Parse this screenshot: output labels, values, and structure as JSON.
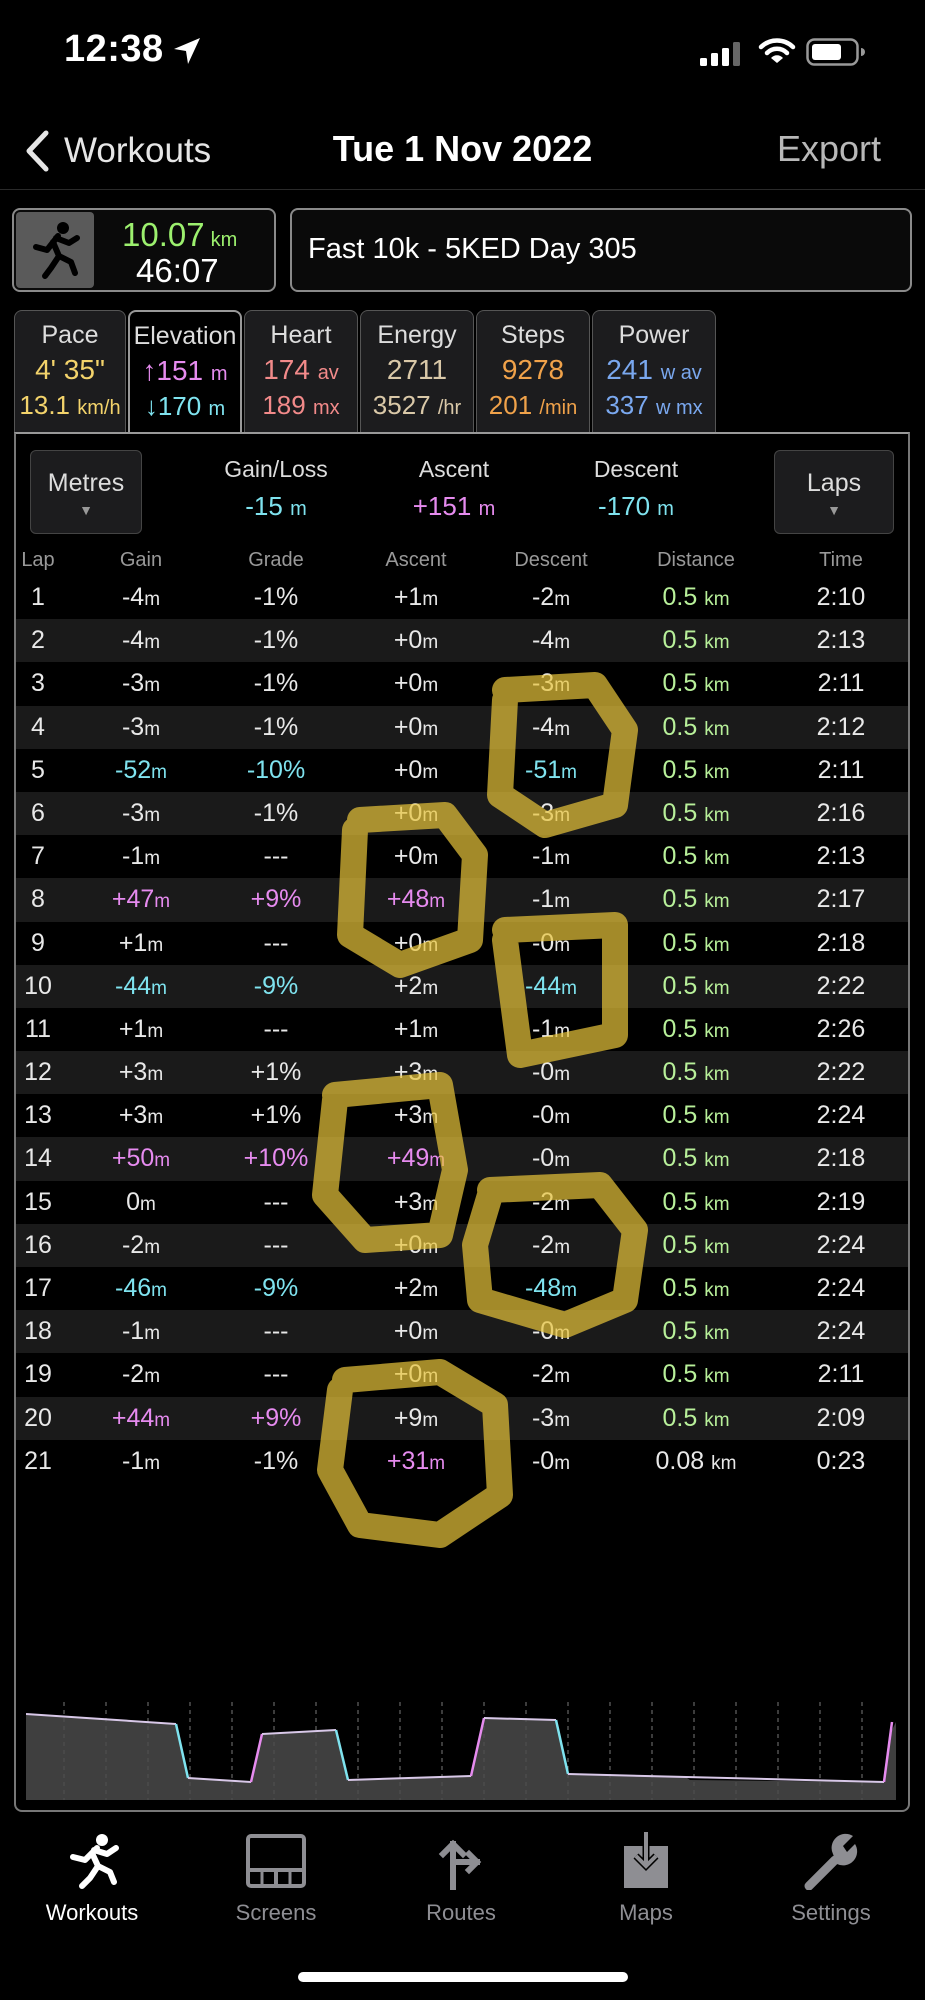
{
  "status_bar": {
    "time": "12:38"
  },
  "nav": {
    "back_label": "Workouts",
    "title": "Tue 1 Nov 2022",
    "export_label": "Export"
  },
  "summary": {
    "distance": "10.07",
    "distance_unit": "km",
    "duration": "46:07",
    "workout_title": "Fast 10k - 5KED Day 305"
  },
  "tabs": [
    {
      "label": "Pace",
      "line1": "4' 35\"",
      "line1_color": "#f3d36b",
      "line2": "13.1",
      "line2_unit": "km/h",
      "line2_color": "#f3d36b"
    },
    {
      "label": "Elevation",
      "line1": "↑151",
      "line1_unit": "m",
      "line1_color": "#e68bef",
      "line2": "↓170",
      "line2_unit": "m",
      "line2_color": "#7fe3ef"
    },
    {
      "label": "Heart",
      "line1": "174",
      "line1_unit": "av",
      "line1_color": "#f28a8a",
      "line2": "189",
      "line2_unit": "mx",
      "line2_color": "#f28a8a"
    },
    {
      "label": "Energy",
      "line1": "2711",
      "line1_color": "#d9c8a8",
      "line2": "3527",
      "line2_unit": "/hr",
      "line2_color": "#d9c8a8"
    },
    {
      "label": "Steps",
      "line1": "9278",
      "line1_color": "#f0a24a",
      "line2": "201",
      "line2_unit": "/min",
      "line2_color": "#f0a24a"
    },
    {
      "label": "Power",
      "line1": "241",
      "line1_unit": "w av",
      "line1_color": "#7aa8ef",
      "line2": "337",
      "line2_unit": "w mx",
      "line2_color": "#7aa8ef"
    }
  ],
  "active_tab": "Elevation",
  "controls": {
    "units_label": "Metres",
    "laps_label": "Laps"
  },
  "stats": {
    "gain_loss_label": "Gain/Loss",
    "gain_loss_value": "-15",
    "gain_loss_unit": "m",
    "ascent_label": "Ascent",
    "ascent_value": "+151",
    "ascent_unit": "m",
    "descent_label": "Descent",
    "descent_value": "-170",
    "descent_unit": "m"
  },
  "table": {
    "headers": [
      "Lap",
      "Gain",
      "Grade",
      "Ascent",
      "Descent",
      "Distance",
      "Time"
    ],
    "rows": [
      {
        "lap": "1",
        "gain": "-4",
        "grade": "-1%",
        "ascent": "+1",
        "descent": "-2",
        "distance": "0.5",
        "time": "2:10"
      },
      {
        "lap": "2",
        "gain": "-4",
        "grade": "-1%",
        "ascent": "+0",
        "descent": "-4",
        "distance": "0.5",
        "time": "2:13"
      },
      {
        "lap": "3",
        "gain": "-3",
        "grade": "-1%",
        "ascent": "+0",
        "descent": "-3",
        "distance": "0.5",
        "time": "2:11"
      },
      {
        "lap": "4",
        "gain": "-3",
        "grade": "-1%",
        "ascent": "+0",
        "descent": "-4",
        "distance": "0.5",
        "time": "2:12"
      },
      {
        "lap": "5",
        "gain": "-52",
        "grade": "-10%",
        "ascent": "+0",
        "descent": "-51",
        "distance": "0.5",
        "time": "2:11"
      },
      {
        "lap": "6",
        "gain": "-3",
        "grade": "-1%",
        "ascent": "+0",
        "descent": "-3",
        "distance": "0.5",
        "time": "2:16"
      },
      {
        "lap": "7",
        "gain": "-1",
        "grade": "---",
        "ascent": "+0",
        "descent": "-1",
        "distance": "0.5",
        "time": "2:13"
      },
      {
        "lap": "8",
        "gain": "+47",
        "grade": "+9%",
        "ascent": "+48",
        "descent": "-1",
        "distance": "0.5",
        "time": "2:17"
      },
      {
        "lap": "9",
        "gain": "+1",
        "grade": "---",
        "ascent": "+0",
        "descent": "-0",
        "distance": "0.5",
        "time": "2:18"
      },
      {
        "lap": "10",
        "gain": "-44",
        "grade": "-9%",
        "ascent": "+2",
        "descent": "-44",
        "distance": "0.5",
        "time": "2:22"
      },
      {
        "lap": "11",
        "gain": "+1",
        "grade": "---",
        "ascent": "+1",
        "descent": "-1",
        "distance": "0.5",
        "time": "2:26"
      },
      {
        "lap": "12",
        "gain": "+3",
        "grade": "+1%",
        "ascent": "+3",
        "descent": "-0",
        "distance": "0.5",
        "time": "2:22"
      },
      {
        "lap": "13",
        "gain": "+3",
        "grade": "+1%",
        "ascent": "+3",
        "descent": "-0",
        "distance": "0.5",
        "time": "2:24"
      },
      {
        "lap": "14",
        "gain": "+50",
        "grade": "+10%",
        "ascent": "+49",
        "descent": "-0",
        "distance": "0.5",
        "time": "2:18"
      },
      {
        "lap": "15",
        "gain": "0",
        "grade": "---",
        "ascent": "+3",
        "descent": "-2",
        "distance": "0.5",
        "time": "2:19"
      },
      {
        "lap": "16",
        "gain": "-2",
        "grade": "---",
        "ascent": "+0",
        "descent": "-2",
        "distance": "0.5",
        "time": "2:24"
      },
      {
        "lap": "17",
        "gain": "-46",
        "grade": "-9%",
        "ascent": "+2",
        "descent": "-48",
        "distance": "0.5",
        "time": "2:24"
      },
      {
        "lap": "18",
        "gain": "-1",
        "grade": "---",
        "ascent": "+0",
        "descent": "-0",
        "distance": "0.5",
        "time": "2:24"
      },
      {
        "lap": "19",
        "gain": "-2",
        "grade": "---",
        "ascent": "+0",
        "descent": "-2",
        "distance": "0.5",
        "time": "2:11"
      },
      {
        "lap": "20",
        "gain": "+44",
        "grade": "+9%",
        "ascent": "+9",
        "descent": "-3",
        "distance": "0.5",
        "time": "2:09"
      },
      {
        "lap": "21",
        "gain": "-1",
        "grade": "-1%",
        "ascent": "+31",
        "descent": "-0",
        "distance": "0.08",
        "time": "0:23"
      }
    ],
    "unit_m": "m",
    "unit_km": "km"
  },
  "tabbar": [
    {
      "label": "Workouts",
      "icon": "runner-icon",
      "active": true
    },
    {
      "label": "Screens",
      "icon": "screens-icon",
      "active": false
    },
    {
      "label": "Routes",
      "icon": "routes-icon",
      "active": false
    },
    {
      "label": "Maps",
      "icon": "maps-icon",
      "active": false
    },
    {
      "label": "Settings",
      "icon": "wrench-icon",
      "active": false
    }
  ],
  "colors": {
    "cyan": "#7fe3ef",
    "magenta": "#e68bef",
    "green": "#b8f09a",
    "highlight": "#e8c53a"
  }
}
